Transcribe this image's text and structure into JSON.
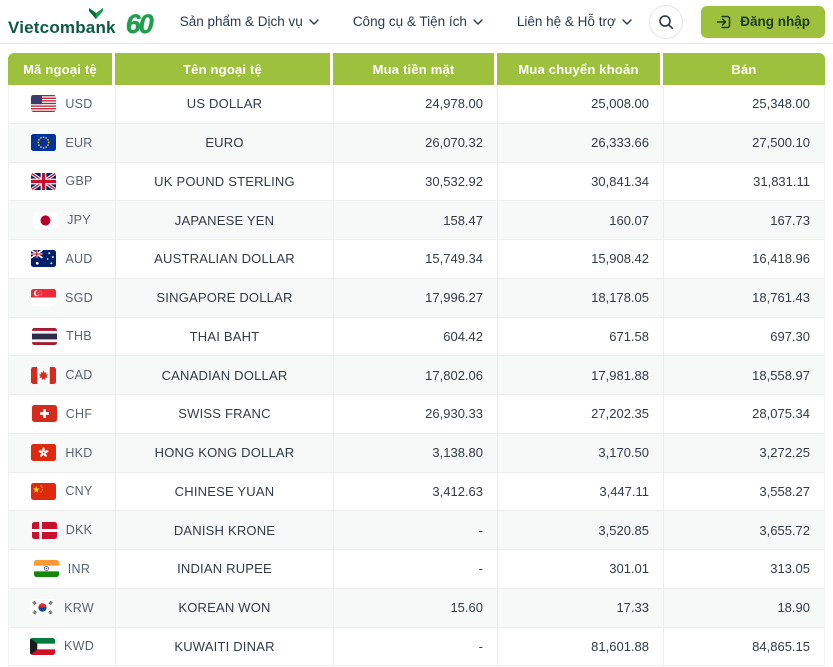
{
  "brand": {
    "name": "Vietcombank",
    "anniversary": "60"
  },
  "nav": {
    "items": [
      {
        "label": "Sản phẩm & Dịch vụ"
      },
      {
        "label": "Công cụ & Tiện ích"
      },
      {
        "label": "Liên hệ & Hỗ trợ"
      }
    ]
  },
  "actions": {
    "login_label": "Đăng nhập"
  },
  "icons": {
    "search": "magnifier",
    "login": "arrow-into-bracket",
    "nav_caret": "chevron-down",
    "brand_mark": "green-check-leaf"
  },
  "colors": {
    "accent_green": "#9ec13d",
    "brand_green": "#0d5a41",
    "stripe": "#f7f8f8"
  },
  "table": {
    "columns": [
      "Mã ngoại tệ",
      "Tên ngoại tệ",
      "Mua tiền mặt",
      "Mua chuyển khoản",
      "Bán"
    ],
    "rows": [
      {
        "flag": "us",
        "code": "USD",
        "name": "US DOLLAR",
        "cash": "24,978.00",
        "transfer": "25,008.00",
        "sell": "25,348.00"
      },
      {
        "flag": "eu",
        "code": "EUR",
        "name": "EURO",
        "cash": "26,070.32",
        "transfer": "26,333.66",
        "sell": "27,500.10"
      },
      {
        "flag": "gb",
        "code": "GBP",
        "name": "UK POUND STERLING",
        "cash": "30,532.92",
        "transfer": "30,841.34",
        "sell": "31,831.11"
      },
      {
        "flag": "jp",
        "code": "JPY",
        "name": "JAPANESE YEN",
        "cash": "158.47",
        "transfer": "160.07",
        "sell": "167.73"
      },
      {
        "flag": "au",
        "code": "AUD",
        "name": "AUSTRALIAN DOLLAR",
        "cash": "15,749.34",
        "transfer": "15,908.42",
        "sell": "16,418.96"
      },
      {
        "flag": "sg",
        "code": "SGD",
        "name": "SINGAPORE DOLLAR",
        "cash": "17,996.27",
        "transfer": "18,178.05",
        "sell": "18,761.43"
      },
      {
        "flag": "th",
        "code": "THB",
        "name": "THAI BAHT",
        "cash": "604.42",
        "transfer": "671.58",
        "sell": "697.30"
      },
      {
        "flag": "ca",
        "code": "CAD",
        "name": "CANADIAN DOLLAR",
        "cash": "17,802.06",
        "transfer": "17,981.88",
        "sell": "18,558.97"
      },
      {
        "flag": "ch",
        "code": "CHF",
        "name": "SWISS FRANC",
        "cash": "26,930.33",
        "transfer": "27,202.35",
        "sell": "28,075.34"
      },
      {
        "flag": "hk",
        "code": "HKD",
        "name": "HONG KONG DOLLAR",
        "cash": "3,138.80",
        "transfer": "3,170.50",
        "sell": "3,272.25"
      },
      {
        "flag": "cn",
        "code": "CNY",
        "name": "CHINESE YUAN",
        "cash": "3,412.63",
        "transfer": "3,447.11",
        "sell": "3,558.27"
      },
      {
        "flag": "dk",
        "code": "DKK",
        "name": "DANISH KRONE",
        "cash": "-",
        "transfer": "3,520.85",
        "sell": "3,655.72"
      },
      {
        "flag": "in",
        "code": "INR",
        "name": "INDIAN RUPEE",
        "cash": "-",
        "transfer": "301.01",
        "sell": "313.05"
      },
      {
        "flag": "kr",
        "code": "KRW",
        "name": "KOREAN WON",
        "cash": "15.60",
        "transfer": "17.33",
        "sell": "18.90"
      },
      {
        "flag": "kw",
        "code": "KWD",
        "name": "KUWAITI DINAR",
        "cash": "-",
        "transfer": "81,601.88",
        "sell": "84,865.15"
      }
    ]
  }
}
